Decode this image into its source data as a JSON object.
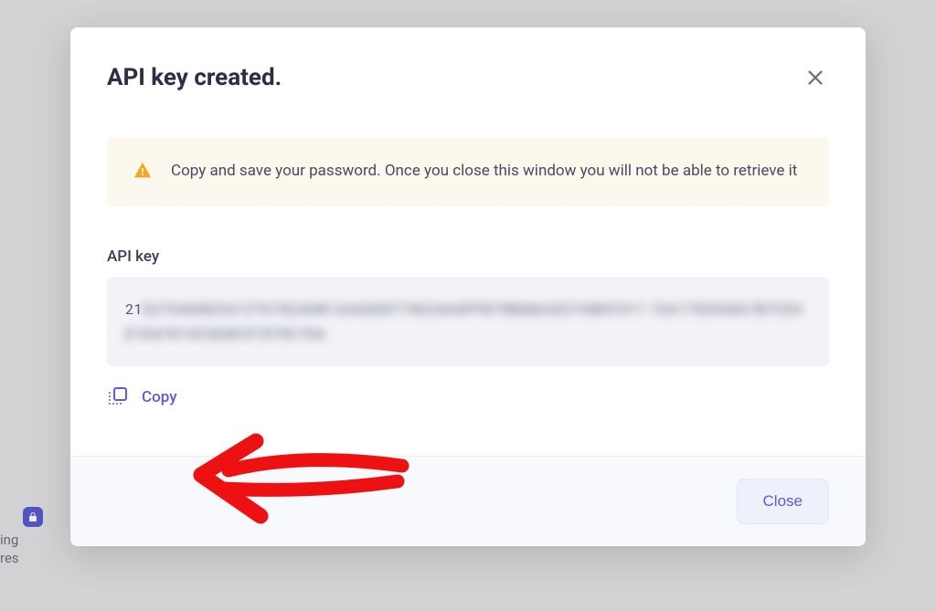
{
  "modal": {
    "title": "API key created.",
    "alert_text": "Copy and save your password. Once you close this window you will not be able to retrieve it",
    "field_label": "API key",
    "key_prefix": "21",
    "key_blurred": "D27G4D8D2A12TA7824GB12AAD0877SE24ASPFB79B6BA2E37AB9C911 72A1753945A7B7CE4E1D47D10C6D8C97579C70A",
    "copy_label": "Copy",
    "close_button_label": "Close"
  },
  "bg": {
    "text1": "ing",
    "text2": "res"
  }
}
